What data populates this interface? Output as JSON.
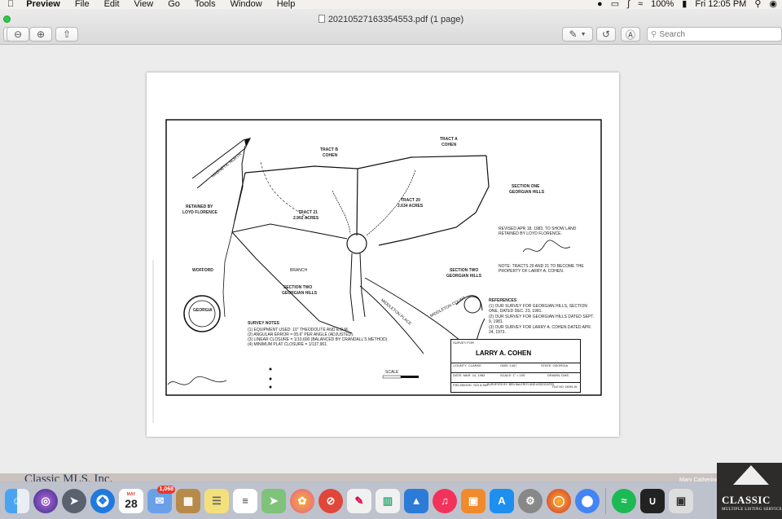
{
  "menubar": {
    "app": "Preview",
    "items": [
      "File",
      "Edit",
      "View",
      "Go",
      "Tools",
      "Window",
      "Help"
    ],
    "battery": "100%",
    "clock": "Fri 12:05 PM"
  },
  "window": {
    "title": "20210527163354553.pdf (1 page)",
    "search_placeholder": "Search"
  },
  "plat": {
    "owner": "LARRY A. COHEN",
    "labels": {
      "tract_b": "TRACT B",
      "tract_b_owner": "COHEN",
      "tract_a": "TRACT A",
      "tract_a_owner": "COHEN",
      "section_one": "SECTION ONE",
      "georgian_hills_1": "GEORGIAN HILLS",
      "tract_21": "TRACT 21",
      "tract_21_acres": "2.902 ACRES",
      "tract_20": "TRACT 20",
      "tract_20_acres": "2.634 ACRES",
      "retained": "RETAINED BY",
      "loyd": "LOYD FLORENCE",
      "wofford": "WOFFORD",
      "section_two_a": "SECTION TWO",
      "georgian_hills_2": "GEORGIAN HILLS",
      "section_two_b": "SECTION TWO",
      "georgian_hills_3": "GEORGIAN HILLS",
      "magnetic": "MAGNETIC NORTH",
      "middleton_court": "MIDDLETON COURT",
      "middleton_place": "MIDDLETON PLACE",
      "branch": "BRANCH",
      "seal_georgia": "GEORGIA",
      "revised": "REVISED APR 18, 1983, TO SHOW LAND RETAINED BY LOYD FLORENCE.",
      "note": "NOTE: TRACTS 20 AND 21 TO BECOME THE PROPERTY OF LARRY A. COHEN.",
      "references_title": "REFERENCES",
      "references": [
        "(1) OUR SURVEY FOR GEORGIAN HILLS, SECTION ONE, DATED DEC. 23, 1981.",
        "(2) OUR SURVEY FOR GEORGIAN HILLS DATED SEPT. 9, 1981.",
        "(3) OUR SURVEY FOR LARRY A. COHEN DATED APR. 24, 1973."
      ],
      "survey_notes_title": "SURVEY NOTES",
      "survey_notes": [
        "(1) EQUIPMENT USED: 10\" THEODOLITE AND E.D.M.",
        "(2) ANGULAR ERROR = 05.6\" PER ANGLE (ADJUSTED).",
        "(3) LINEAR CLOSURE = 1/10,600 (BALANCED BY CRANDALL'S METHOD).",
        "(4) MINIMUM PLAT CLOSURE = 1/137,961."
      ],
      "scale": "SCALE",
      "title_block": {
        "survey_for": "SURVEY FOR",
        "county": "COUNTY: CLARKE",
        "gmd": "GMD: 1467",
        "state": "STATE: GEORGIA",
        "date": "DATE: MAR. 14, 1983",
        "scale": "SCALE: 1\" = 100'",
        "drawn": "DRAWN: DMS",
        "fieldbook": "FIELDBOOK: SOI 8.552",
        "surveyed_by": "SURVEYED BY: BEN McLEROY AND ASSOCIATES",
        "file_no": "FILE NO: 15099-25"
      }
    }
  },
  "background": {
    "mls_text": "Classic MLS, Inc.",
    "agent_text": "Mary Catherine Smith",
    "logo": "CLASSIC",
    "logo_sub": "MULTIPLE LISTING SERVICE"
  },
  "dock": {
    "calendar_month": "MAY",
    "calendar_day": "28",
    "mail_badge": "1,068"
  }
}
